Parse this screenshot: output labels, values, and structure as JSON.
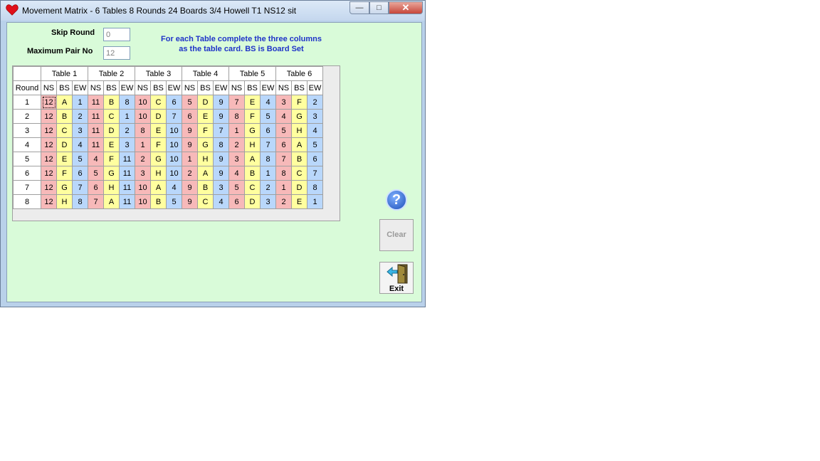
{
  "window": {
    "title": "Movement Matrix -  6 Tables  8 Rounds 24 Boards  3/4 Howell T1 NS12 sit",
    "controls": {
      "minimize": "—",
      "maximize": "□",
      "close": "✕"
    }
  },
  "form": {
    "skip_round_label": "Skip Round",
    "skip_round_value": "0",
    "max_pair_label": "Maximum Pair No",
    "max_pair_value": "12",
    "info_line1": "For each Table complete the three columns",
    "info_line2": "as the table card. BS is Board Set"
  },
  "grid": {
    "tables": [
      "Table 1",
      "Table 2",
      "Table 3",
      "Table 4",
      "Table 5",
      "Table 6"
    ],
    "round_header": "Round",
    "subheaders": [
      "NS",
      "BS",
      "EW"
    ],
    "rows": [
      {
        "round": "1",
        "cells": [
          "12",
          "A",
          "1",
          "11",
          "B",
          "8",
          "10",
          "C",
          "6",
          "5",
          "D",
          "9",
          "7",
          "E",
          "4",
          "3",
          "F",
          "2"
        ]
      },
      {
        "round": "2",
        "cells": [
          "12",
          "B",
          "2",
          "11",
          "C",
          "1",
          "10",
          "D",
          "7",
          "6",
          "E",
          "9",
          "8",
          "F",
          "5",
          "4",
          "G",
          "3"
        ]
      },
      {
        "round": "3",
        "cells": [
          "12",
          "C",
          "3",
          "11",
          "D",
          "2",
          "8",
          "E",
          "10",
          "9",
          "F",
          "7",
          "1",
          "G",
          "6",
          "5",
          "H",
          "4"
        ]
      },
      {
        "round": "4",
        "cells": [
          "12",
          "D",
          "4",
          "11",
          "E",
          "3",
          "1",
          "F",
          "10",
          "9",
          "G",
          "8",
          "2",
          "H",
          "7",
          "6",
          "A",
          "5"
        ]
      },
      {
        "round": "5",
        "cells": [
          "12",
          "E",
          "5",
          "4",
          "F",
          "11",
          "2",
          "G",
          "10",
          "1",
          "H",
          "9",
          "3",
          "A",
          "8",
          "7",
          "B",
          "6"
        ]
      },
      {
        "round": "6",
        "cells": [
          "12",
          "F",
          "6",
          "5",
          "G",
          "11",
          "3",
          "H",
          "10",
          "2",
          "A",
          "9",
          "4",
          "B",
          "1",
          "8",
          "C",
          "7"
        ]
      },
      {
        "round": "7",
        "cells": [
          "12",
          "G",
          "7",
          "6",
          "H",
          "11",
          "10",
          "A",
          "4",
          "9",
          "B",
          "3",
          "5",
          "C",
          "2",
          "1",
          "D",
          "8"
        ]
      },
      {
        "round": "8",
        "cells": [
          "12",
          "H",
          "8",
          "7",
          "A",
          "11",
          "10",
          "B",
          "5",
          "9",
          "C",
          "4",
          "6",
          "D",
          "3",
          "2",
          "E",
          "1"
        ]
      }
    ]
  },
  "buttons": {
    "help": "?",
    "clear": "Clear",
    "exit": "Exit"
  },
  "colors": {
    "ns": "#f7b9b9",
    "bs": "#ffff9f",
    "ew": "#b9d7fb",
    "client_bg": "#d9fbd9",
    "info_text": "#1f33c8"
  }
}
